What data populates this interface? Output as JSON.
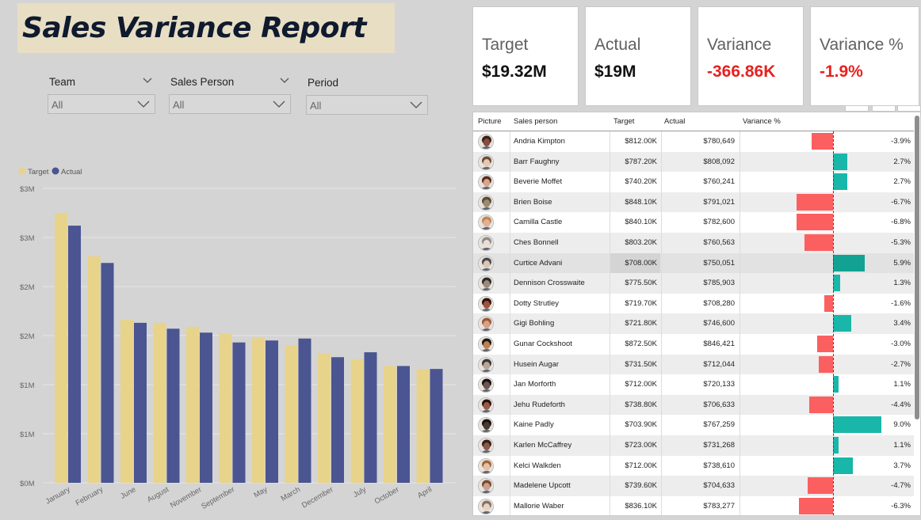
{
  "title": "Sales Variance Report",
  "filters": [
    {
      "label": "Team",
      "value": "All"
    },
    {
      "label": "Sales Person",
      "value": "All"
    },
    {
      "label": "Period",
      "value": "All"
    }
  ],
  "kpis": [
    {
      "label": "Target",
      "value": "$19.32M",
      "negative": false
    },
    {
      "label": "Actual",
      "value": "$19M",
      "negative": false
    },
    {
      "label": "Variance",
      "value": "-366.86K",
      "negative": true
    },
    {
      "label": "Variance %",
      "value": "-1.9%",
      "negative": true
    }
  ],
  "chart_data": {
    "type": "bar",
    "categories": [
      "January",
      "February",
      "June",
      "August",
      "November",
      "September",
      "May",
      "March",
      "December",
      "July",
      "October",
      "April"
    ],
    "series": [
      {
        "name": "Target",
        "color": "#e8d38b",
        "values": [
          2.75,
          2.31,
          1.66,
          1.63,
          1.59,
          1.52,
          1.48,
          1.4,
          1.32,
          1.26,
          1.19,
          1.16
        ]
      },
      {
        "name": "Actual",
        "color": "#4a5591",
        "values": [
          2.62,
          2.24,
          1.63,
          1.57,
          1.53,
          1.43,
          1.45,
          1.47,
          1.28,
          1.33,
          1.19,
          1.16
        ]
      }
    ],
    "y_ticks": [
      {
        "value": 0,
        "label": "$0M"
      },
      {
        "value": 0.5,
        "label": "$1M"
      },
      {
        "value": 1.0,
        "label": "$1M"
      },
      {
        "value": 1.5,
        "label": "$2M"
      },
      {
        "value": 2.0,
        "label": "$2M"
      },
      {
        "value": 2.5,
        "label": "$3M"
      },
      {
        "value": 3.0,
        "label": "$3M"
      }
    ],
    "ylim": [
      0,
      3.0
    ],
    "grid": true,
    "legend": "top-left"
  },
  "table": {
    "columns": [
      "Picture",
      "Sales person",
      "Target",
      "Actual",
      "Variance %"
    ],
    "rows": [
      {
        "name": "Andria Kimpton",
        "target": "$812.00K",
        "actual": "$780,649",
        "variance": "-3.9%",
        "pct": -3.9,
        "skin": "#8a4a3e",
        "hair": "#3a1f1a"
      },
      {
        "name": "Barr Faughny",
        "target": "$787.20K",
        "actual": "$808,092",
        "variance": "2.7%",
        "pct": 2.7,
        "skin": "#e7c6b3",
        "hair": "#6b4e3a"
      },
      {
        "name": "Beverie Moffet",
        "target": "$740.20K",
        "actual": "$760,241",
        "variance": "2.7%",
        "pct": 2.7,
        "skin": "#d7a48c",
        "hair": "#5a2c1f"
      },
      {
        "name": "Brien Boise",
        "target": "$848.10K",
        "actual": "$791,021",
        "variance": "-6.7%",
        "pct": -6.7,
        "skin": "#9a8a72",
        "hair": "#5a4a3a"
      },
      {
        "name": "Camilla Castle",
        "target": "$840.10K",
        "actual": "$782,600",
        "variance": "-6.8%",
        "pct": -6.8,
        "skin": "#e0b09a",
        "hair": "#c2874f"
      },
      {
        "name": "Ches Bonnell",
        "target": "$803.20K",
        "actual": "$760,563",
        "variance": "-5.3%",
        "pct": -5.3,
        "skin": "#eaded6",
        "hair": "#8c8c8c"
      },
      {
        "name": "Curtice Advani",
        "target": "$708.00K",
        "actual": "$750,051",
        "variance": "5.9%",
        "pct": 5.9,
        "skin": "#d9c6b8",
        "hair": "#4a4a4a"
      },
      {
        "name": "Dennison Crosswaite",
        "target": "$775.50K",
        "actual": "$785,903",
        "variance": "1.3%",
        "pct": 1.3,
        "skin": "#9c8a7a",
        "hair": "#2a2a2a"
      },
      {
        "name": "Dotty Strutley",
        "target": "$719.70K",
        "actual": "$708,280",
        "variance": "-1.6%",
        "pct": -1.6,
        "skin": "#a0523e",
        "hair": "#2e1410"
      },
      {
        "name": "Gigi Bohling",
        "target": "$721.80K",
        "actual": "$746,600",
        "variance": "3.4%",
        "pct": 3.4,
        "skin": "#d7a08a",
        "hair": "#9a5a36"
      },
      {
        "name": "Gunar Cockshoot",
        "target": "$872.50K",
        "actual": "$846,421",
        "variance": "-3.0%",
        "pct": -3.0,
        "skin": "#c08050",
        "hair": "#1e1a14"
      },
      {
        "name": "Husein Augar",
        "target": "$731.50K",
        "actual": "$712,044",
        "variance": "-2.7%",
        "pct": -2.7,
        "skin": "#b9a69a",
        "hair": "#3a3a3a"
      },
      {
        "name": "Jan Morforth",
        "target": "$712.00K",
        "actual": "$720,133",
        "variance": "1.1%",
        "pct": 1.1,
        "skin": "#6e5650",
        "hair": "#1a1212"
      },
      {
        "name": "Jehu Rudeforth",
        "target": "$738.80K",
        "actual": "$706,633",
        "variance": "-4.4%",
        "pct": -4.4,
        "skin": "#9a5a48",
        "hair": "#2a1410"
      },
      {
        "name": "Kaine Padly",
        "target": "$703.90K",
        "actual": "$767,259",
        "variance": "9.0%",
        "pct": 9.0,
        "skin": "#4a3a32",
        "hair": "#1a1414"
      },
      {
        "name": "Karlen McCaffrey",
        "target": "$723.00K",
        "actual": "$731,268",
        "variance": "1.1%",
        "pct": 1.1,
        "skin": "#8a5a4a",
        "hair": "#3a1e16"
      },
      {
        "name": "Kelci Walkden",
        "target": "$712.00K",
        "actual": "$738,610",
        "variance": "3.7%",
        "pct": 3.7,
        "skin": "#e6c0a6",
        "hair": "#a0683a"
      },
      {
        "name": "Madelene Upcott",
        "target": "$739.60K",
        "actual": "$704,633",
        "variance": "-4.7%",
        "pct": -4.7,
        "skin": "#c8a090",
        "hair": "#7a4a30"
      },
      {
        "name": "Mallorie Waber",
        "target": "$836.10K",
        "actual": "$783,277",
        "variance": "-6.3%",
        "pct": -6.3,
        "skin": "#e4d2c6",
        "hair": "#8a7060"
      }
    ],
    "colors": {
      "positive": "#18b7a9",
      "negative": "#fc5f5f"
    }
  }
}
